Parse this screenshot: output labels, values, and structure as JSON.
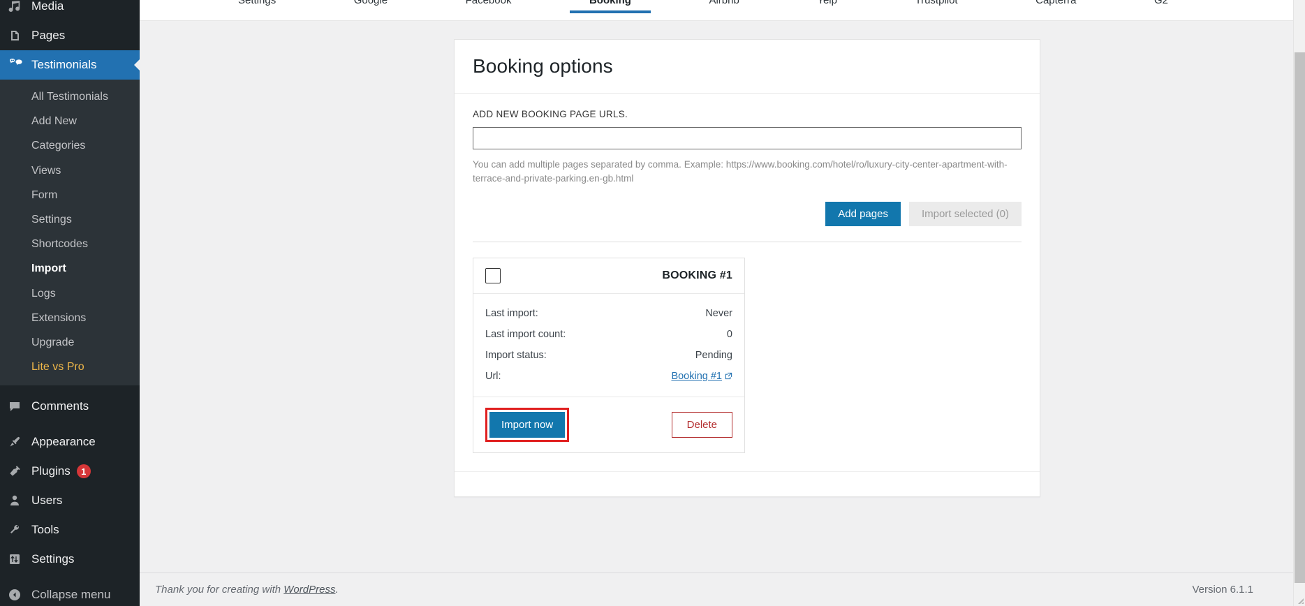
{
  "sidebar": {
    "top_items": [
      {
        "label": "Media",
        "icon": "media-icon"
      },
      {
        "label": "Pages",
        "icon": "pages-icon"
      }
    ],
    "current_item": {
      "label": "Testimonials",
      "icon": "testimonials-icon"
    },
    "submenu": [
      {
        "label": "All Testimonials",
        "state": "normal"
      },
      {
        "label": "Add New",
        "state": "normal"
      },
      {
        "label": "Categories",
        "state": "normal"
      },
      {
        "label": "Views",
        "state": "normal"
      },
      {
        "label": "Form",
        "state": "normal"
      },
      {
        "label": "Settings",
        "state": "normal"
      },
      {
        "label": "Shortcodes",
        "state": "normal"
      },
      {
        "label": "Import",
        "state": "current"
      },
      {
        "label": "Logs",
        "state": "normal"
      },
      {
        "label": "Extensions",
        "state": "normal"
      },
      {
        "label": "Upgrade",
        "state": "normal"
      },
      {
        "label": "Lite vs Pro",
        "state": "pro"
      }
    ],
    "bottom_items": [
      {
        "label": "Comments",
        "icon": "comments-icon",
        "badge": ""
      },
      {
        "label": "Appearance",
        "icon": "appearance-icon",
        "badge": ""
      },
      {
        "label": "Plugins",
        "icon": "plugins-icon",
        "badge": "1"
      },
      {
        "label": "Users",
        "icon": "users-icon",
        "badge": ""
      },
      {
        "label": "Tools",
        "icon": "tools-icon",
        "badge": ""
      },
      {
        "label": "Settings",
        "icon": "settings-icon",
        "badge": ""
      }
    ],
    "collapse": {
      "label": "Collapse menu",
      "icon": "collapse-arrow-icon"
    }
  },
  "tabs": [
    {
      "label": "Settings",
      "active": false
    },
    {
      "label": "Google",
      "active": false
    },
    {
      "label": "Facebook",
      "active": false
    },
    {
      "label": "Booking",
      "active": true
    },
    {
      "label": "Airbnb",
      "active": false
    },
    {
      "label": "Yelp",
      "active": false
    },
    {
      "label": "Trustpilot",
      "active": false
    },
    {
      "label": "Capterra",
      "active": false
    },
    {
      "label": "G2",
      "active": false
    }
  ],
  "card": {
    "title": "Booking options",
    "url_field_label": "ADD NEW BOOKING PAGE URLS.",
    "url_field_value": "",
    "url_field_placeholder": "",
    "helper_text": "You can add multiple pages separated by comma. Example: https://www.booking.com/hotel/ro/luxury-city-center-apartment-with-terrace-and-private-parking.en-gb.html",
    "add_pages_label": "Add pages",
    "import_selected_label": "Import selected (0)"
  },
  "booking_item": {
    "title": "BOOKING #1",
    "checkbox_checked": false,
    "rows": [
      {
        "label": "Last import:",
        "value": "Never",
        "is_link": false
      },
      {
        "label": "Last import count:",
        "value": "0",
        "is_link": false
      },
      {
        "label": "Import status:",
        "value": "Pending",
        "is_link": false
      },
      {
        "label": "Url:",
        "value": "Booking #1",
        "is_link": true
      }
    ],
    "import_now_label": "Import now",
    "delete_label": "Delete",
    "import_now_highlighted": true
  },
  "footer": {
    "thanks_prefix": "Thank you for creating with ",
    "wordpress_link": "WordPress",
    "thanks_suffix": ".",
    "version": "Version 6.1.1"
  },
  "colors": {
    "accent_blue": "#2271b1",
    "button_blue": "#1277ad",
    "danger_red": "#b32d2e",
    "highlight_red": "#e02020",
    "sidebar_bg": "#1d2327",
    "submenu_bg": "#2c3338",
    "pro_gold": "#f0b849"
  }
}
